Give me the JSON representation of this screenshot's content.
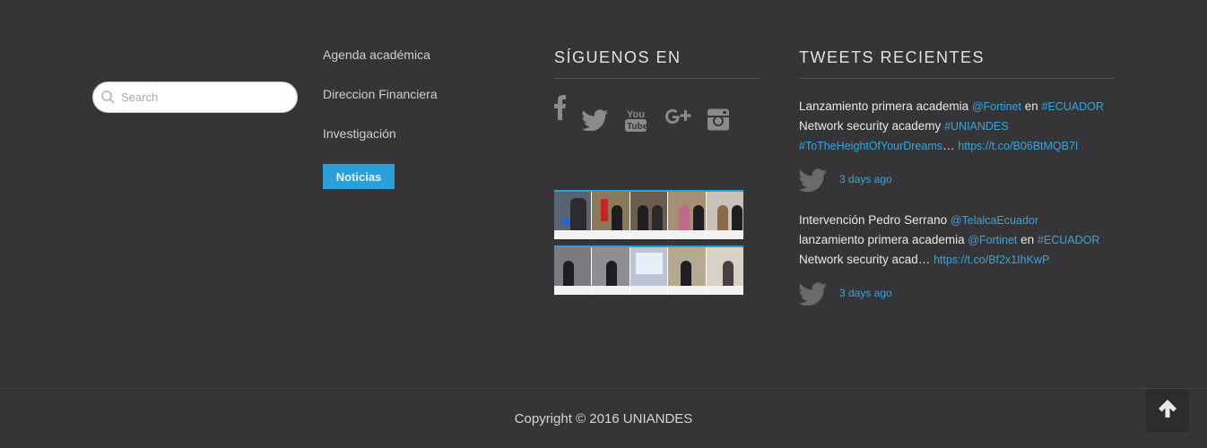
{
  "search": {
    "placeholder": "Search"
  },
  "links": {
    "items": [
      "Agenda académica",
      "Direccion Financiera",
      "Investigación"
    ],
    "button": "Noticias"
  },
  "social": {
    "title": "SÍGUENOS EN",
    "icons": [
      "facebook-icon",
      "twitter-icon",
      "youtube-icon",
      "google-plus-icon",
      "instagram-icon"
    ],
    "youtube_text": [
      "You",
      "Tube"
    ]
  },
  "tweets": {
    "title": "TWEETS RECIENTES",
    "items": [
      {
        "t1": "Lanzamiento primera academia ",
        "m1": "@Fortinet",
        "t2": " en ",
        "h1": "#ECUADOR",
        "t3": "Network security academy ",
        "h2": "#UNIANDES",
        "h3": "#ToTheHeightOfYourDreams",
        "t4": "… ",
        "url": "https://t.co/B06BtMQB7I",
        "ago": "3 days ago"
      },
      {
        "t1": "Intervención Pedro Serrano ",
        "m1": "@TelalcaEcuador",
        "t2": "lanzamiento primera academia ",
        "m2": "@Fortinet",
        "t3": " en ",
        "h1": "#ECUADOR",
        "t4": "Network security acad… ",
        "url": "https://t.co/Bf2x1IhKwP",
        "ago": "3 days ago"
      }
    ]
  },
  "footer": {
    "copyright": "Copyright © 2016 UNIANDES"
  },
  "colors": {
    "background": "#353537",
    "accent": "#2a9fd8",
    "link": "#3aa4dc"
  }
}
